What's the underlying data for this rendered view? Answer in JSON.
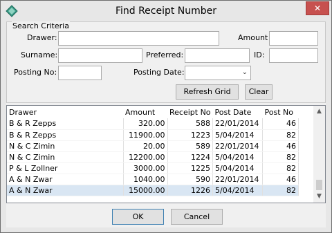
{
  "window": {
    "title": "Find Receipt Number",
    "close_glyph": "✕"
  },
  "criteria": {
    "legend": "Search Criteria",
    "drawer_label": "Drawer:",
    "amount_label": "Amount",
    "surname_label": "Surname:",
    "preferred_label": "Preferred:",
    "id_label": "ID:",
    "posting_no_label": "Posting No:",
    "posting_date_label": "Posting Date:",
    "drawer_value": "",
    "amount_value": "",
    "surname_value": "",
    "preferred_value": "",
    "id_value": "",
    "posting_no_value": "",
    "posting_date_value": "",
    "refresh_label": "Refresh Grid",
    "clear_label": "Clear"
  },
  "grid": {
    "columns": [
      "Drawer",
      "Amount",
      "Receipt No",
      "Post Date",
      "Post No"
    ],
    "rows": [
      [
        "B & R Zepps",
        "320.00",
        "588",
        "22/01/2014",
        "46"
      ],
      [
        "B & R Zepps",
        "11900.00",
        "1223",
        "5/04/2014",
        "82"
      ],
      [
        "N & C Zimin",
        "20.00",
        "589",
        "22/01/2014",
        "46"
      ],
      [
        "N & C Zimin",
        "12200.00",
        "1224",
        "5/04/2014",
        "82"
      ],
      [
        "P & L Zollner",
        "3000.00",
        "1225",
        "5/04/2014",
        "82"
      ],
      [
        "A & N Zwar",
        "1040.00",
        "590",
        "22/01/2014",
        "46"
      ],
      [
        "A & N Zwar",
        "15000.00",
        "1226",
        "5/04/2014",
        "82"
      ]
    ],
    "selected_row": 6,
    "scroll_up_glyph": "▲",
    "scroll_down_glyph": "▼"
  },
  "footer": {
    "ok_label": "OK",
    "cancel_label": "Cancel"
  },
  "icons": {
    "app": "app-diamond-icon",
    "combo_arrow": "⌄"
  },
  "colors": {
    "selected_row": "#d9e6f3",
    "close_button": "#c7514f"
  }
}
